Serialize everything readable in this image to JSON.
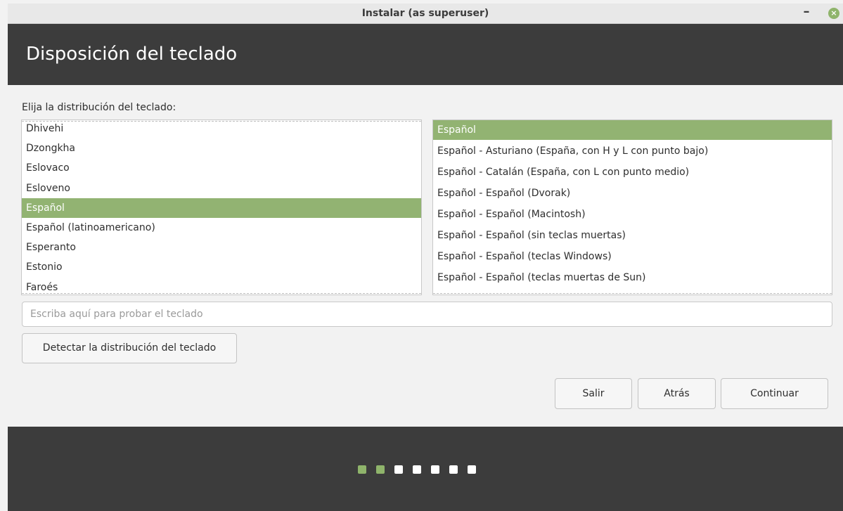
{
  "window": {
    "title": "Instalar (as superuser)",
    "minimize_label": "–",
    "close_label": "×"
  },
  "header": {
    "title": "Disposición del teclado"
  },
  "instruction": "Elija la distribución del teclado:",
  "layout_list": {
    "items": [
      "Dhivehi",
      "Dzongkha",
      "Eslovaco",
      "Esloveno",
      "Español",
      "Español (latinoamericano)",
      "Esperanto",
      "Estonio",
      "Faroés"
    ],
    "selected": "Español"
  },
  "variant_list": {
    "items": [
      "Español",
      "Español - Asturiano (España, con H y L con punto bajo)",
      "Español - Catalán (España, con L con punto medio)",
      "Español - Español (Dvorak)",
      "Español - Español (Macintosh)",
      "Español - Español (sin teclas muertas)",
      "Español - Español (teclas Windows)",
      "Español - Español (teclas muertas de Sun)"
    ],
    "selected": "Español"
  },
  "test_input": {
    "placeholder": "Escriba aquí para probar el teclado",
    "value": ""
  },
  "buttons": {
    "detect": "Detectar la distribución del teclado",
    "quit": "Salir",
    "back": "Atrás",
    "continue": "Continuar"
  },
  "progress": {
    "total_steps": 7,
    "completed_steps": 2
  },
  "colors": {
    "accent": "#92b372",
    "header_bg": "#3c3c3c"
  }
}
